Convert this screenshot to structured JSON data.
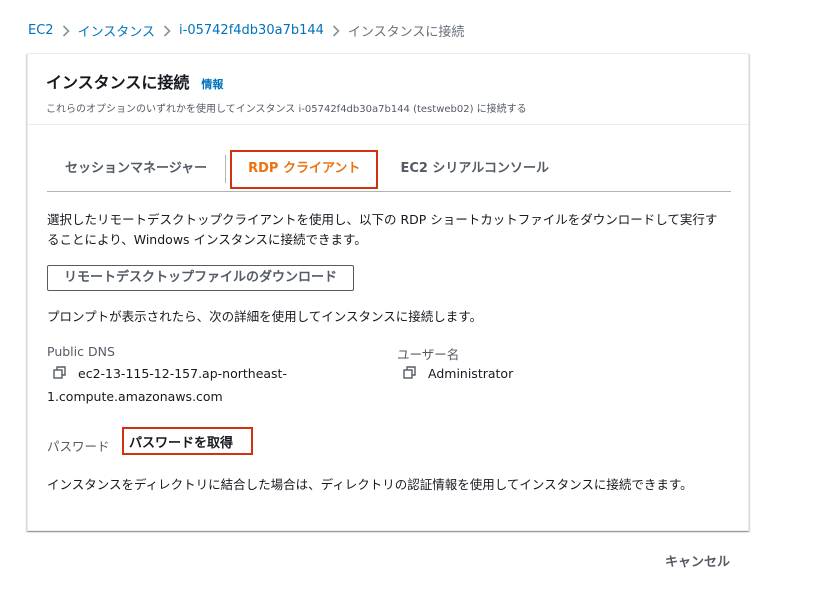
{
  "breadcrumb": {
    "items": [
      "EC2",
      "インスタンス",
      "i-05742f4db30a7b144",
      "インスタンスに接続"
    ]
  },
  "header": {
    "title": "インスタンスに接続",
    "info_link": "情報",
    "description": "これらのオプションのいずれかを使用してインスタンス i-05742f4db30a7b144 (testweb02) に接続する"
  },
  "tabs": {
    "items": [
      "セッションマネージャー",
      "RDP クライアント",
      "EC2 シリアルコンソール"
    ],
    "active": "RDP クライアント"
  },
  "rdp": {
    "intro_line1": "選択したリモートデスクトップクライアントを使用し、以下の RDP ショートカットファイルをダウンロードして実行す",
    "intro_line2": "ることにより、Windows インスタンスに接続できます。",
    "download_button": "リモートデスクトップファイルのダウンロード",
    "prompt_text": "プロンプトが表示されたら、次の詳細を使用してインスタンスに接続します。",
    "public_dns_label": "Public DNS",
    "public_dns_line1": "ec2-13-115-12-157.ap-northeast-",
    "public_dns_line2": "1.compute.amazonaws.com",
    "username_label": "ユーザー名",
    "username_value": "Administrator",
    "password_label": "パスワード",
    "password_link": "パスワードを取得",
    "directory_note": "インスタンスをディレクトリに結合した場合は、ディレクトリの認証情報を使用してインスタンスに接続できます。"
  },
  "footer": {
    "cancel_button": "キャンセル"
  },
  "colors": {
    "link": "#0073bb",
    "active_tab": "#ec7211",
    "highlight_box": "#d13212"
  },
  "icons": {
    "copy": "copy-icon",
    "separator": "chevron-right-icon"
  }
}
